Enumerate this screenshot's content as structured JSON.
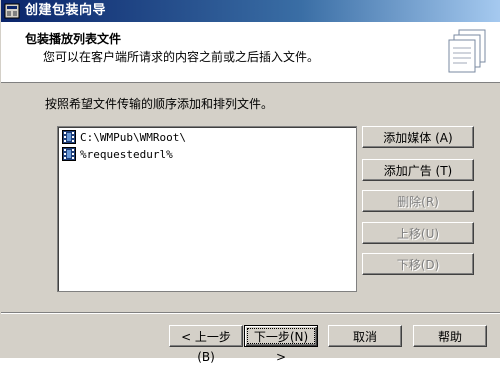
{
  "window": {
    "title": "创建包装向导"
  },
  "header": {
    "title": "包装播放列表文件",
    "subtitle": "您可以在客户端所请求的内容之前或之后插入文件。",
    "icon": "documents-stack-icon"
  },
  "instruction": "按照希望文件传输的顺序添加和排列文件。",
  "files": [
    {
      "path": "C:\\WMPub\\WMRoot\\",
      "icon": "media-file-icon"
    },
    {
      "path": "%requestedurl%",
      "icon": "media-file-icon"
    }
  ],
  "side_buttons": {
    "add_media": "添加媒体 (A)",
    "add_ad": "添加广告 (T)",
    "delete": "删除(R)",
    "move_up": "上移(U)",
    "move_down": "下移(D)"
  },
  "footer": {
    "back": "< 上一步(B)",
    "next": "下一步(N) >",
    "cancel": "取消",
    "help": "帮助"
  }
}
